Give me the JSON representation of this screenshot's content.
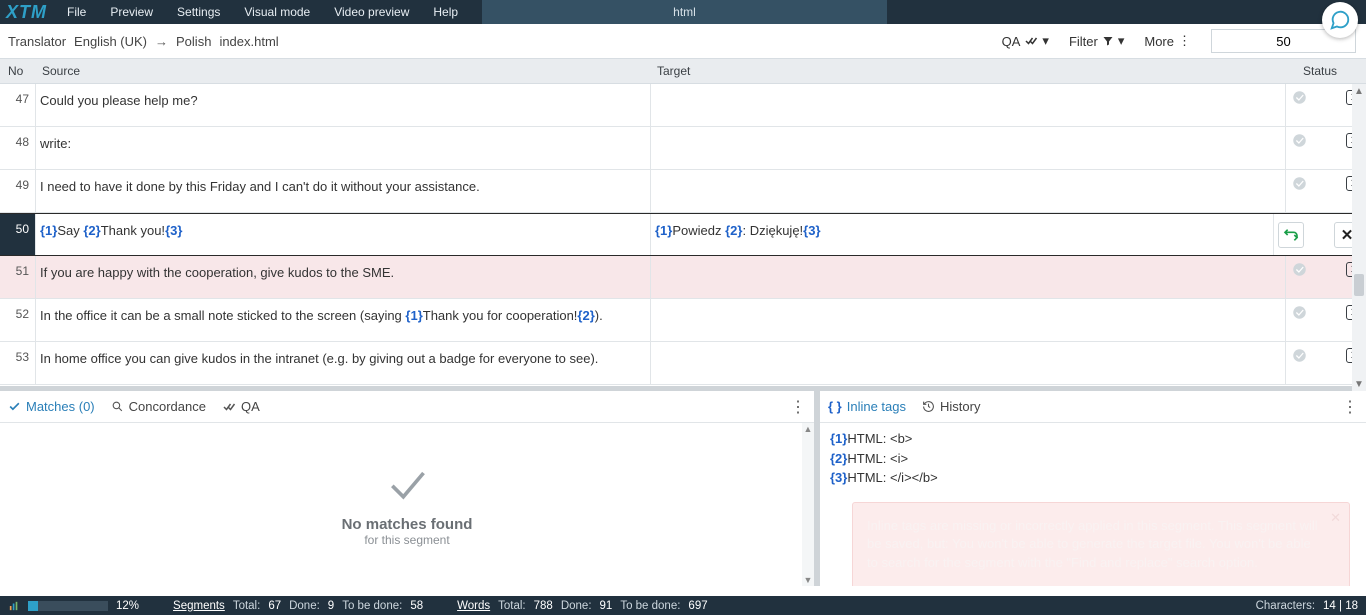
{
  "menubar": {
    "logo": "XTM",
    "items": [
      "File",
      "Preview",
      "Settings",
      "Visual mode",
      "Video preview",
      "Help"
    ],
    "doc_tab": "html"
  },
  "subbar": {
    "role": "Translator",
    "src_lang": "English (UK)",
    "tgt_lang": "Polish",
    "file": "index.html",
    "qa_label": "QA",
    "filter_label": "Filter",
    "more_label": "More",
    "seg_search_value": "50"
  },
  "columns": {
    "no": "No",
    "source": "Source",
    "target": "Target",
    "status": "Status"
  },
  "segments": [
    {
      "no": 47,
      "source_plain": "Could you please help me?",
      "target_plain": "",
      "status_box": "1"
    },
    {
      "no": 48,
      "source_plain": "write:",
      "target_plain": "",
      "status_box": "1"
    },
    {
      "no": 49,
      "source_plain": "I need to have it done by this Friday and I can't do it without your assistance.",
      "target_plain": "",
      "status_box": "1"
    },
    {
      "no": 50,
      "active": true,
      "source_parts": [
        {
          "t": "tag",
          "v": "{1}"
        },
        {
          "t": "txt",
          "v": "Say "
        },
        {
          "t": "tag",
          "v": "{2}"
        },
        {
          "t": "txt",
          "v": "Thank you!"
        },
        {
          "t": "tag",
          "v": "{3}"
        }
      ],
      "target_parts": [
        {
          "t": "tag",
          "v": "{1}"
        },
        {
          "t": "txt",
          "v": "Powiedz "
        },
        {
          "t": "tag",
          "v": "{2}"
        },
        {
          "t": "txt",
          "v": ": Dziękuję!"
        },
        {
          "t": "tag",
          "v": "{3}"
        }
      ],
      "status_box": "1"
    },
    {
      "no": 51,
      "joined": true,
      "source_plain": "If you are happy with the cooperation, give kudos to the SME.",
      "target_plain": "",
      "status_box": "1"
    },
    {
      "no": 52,
      "source_parts": [
        {
          "t": "txt",
          "v": "In the office it can be a small note sticked to the screen (saying "
        },
        {
          "t": "tag",
          "v": "{1}"
        },
        {
          "t": "txt",
          "v": "Thank you for cooperation!"
        },
        {
          "t": "tag",
          "v": "{2}"
        },
        {
          "t": "txt",
          "v": ")."
        }
      ],
      "target_plain": "",
      "status_box": "1"
    },
    {
      "no": 53,
      "source_plain": "In home office you can give kudos in the intranet (e.g. by giving out a badge for everyone to see).",
      "target_plain": "",
      "status_box": "1"
    }
  ],
  "left_panel": {
    "tabs": {
      "matches": "Matches (0)",
      "concordance": "Concordance",
      "qa": "QA"
    },
    "nomatch_title": "No matches found",
    "nomatch_sub": "for this segment"
  },
  "right_panel": {
    "tabs": {
      "inline": "Inline tags",
      "history": "History"
    },
    "inline_tags": [
      {
        "tag": "{1}",
        "desc": "HTML: <b>"
      },
      {
        "tag": "{2}",
        "desc": "HTML: <i>"
      },
      {
        "tag": "{3}",
        "desc": "HTML: </i></b>"
      }
    ],
    "warning": "Inline tags are missing or incorrectly applied in this segment. This segment will be saved, but: You won't be able to generate the target file. You won't be able to search for the segment with the \"Find and replace\" search option."
  },
  "footer": {
    "progress_pct": 12,
    "pct_label": "12%",
    "segments_label": "Segments",
    "segments_total_label": "Total:",
    "segments_total": "67",
    "segments_done_label": "Done:",
    "segments_done": "9",
    "segments_todo_label": "To be done:",
    "segments_todo": "58",
    "words_label": "Words",
    "words_total_label": "Total:",
    "words_total": "788",
    "words_done_label": "Done:",
    "words_done": "91",
    "words_todo_label": "To be done:",
    "words_todo": "697",
    "chars_label": "Characters:",
    "chars_value": "14 | 18"
  }
}
